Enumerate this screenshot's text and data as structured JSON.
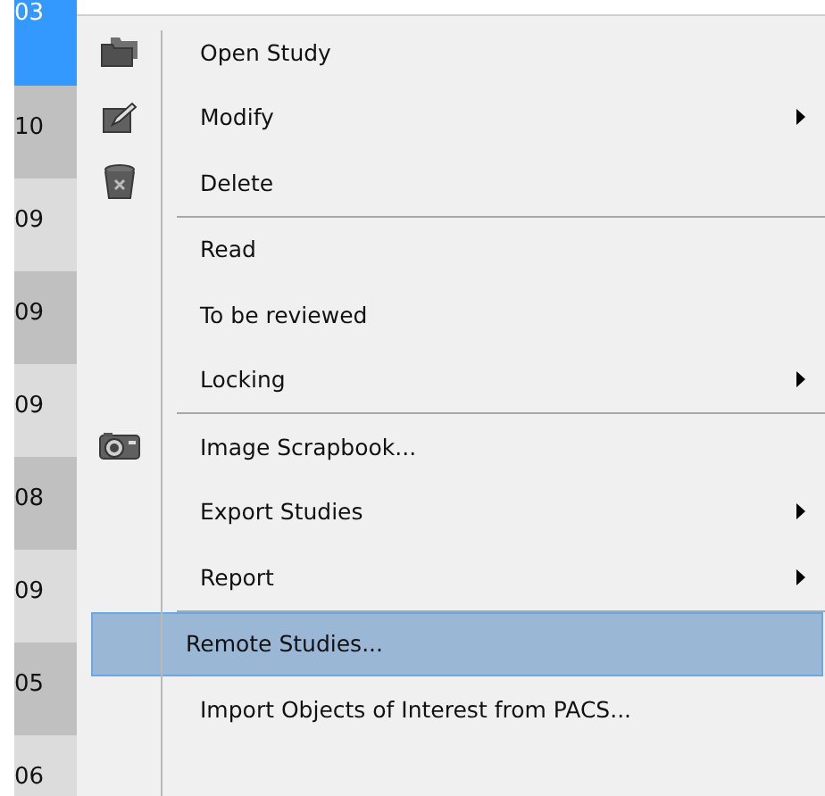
{
  "list_cells": [
    {
      "text": "03",
      "selected": true
    },
    {
      "text": "10",
      "selected": false
    },
    {
      "text": "09",
      "selected": false
    },
    {
      "text": "09",
      "selected": false
    },
    {
      "text": "09",
      "selected": false
    },
    {
      "text": "08",
      "selected": false
    },
    {
      "text": "09",
      "selected": false
    },
    {
      "text": "05",
      "selected": false
    },
    {
      "text": "06",
      "selected": false
    }
  ],
  "context_menu": {
    "items": [
      {
        "kind": "item",
        "label": "Open Study",
        "submenu": false,
        "selected": false
      },
      {
        "kind": "item",
        "label": "Modify",
        "submenu": true,
        "selected": false
      },
      {
        "kind": "item",
        "label": "Delete",
        "submenu": false,
        "selected": false
      },
      {
        "kind": "separator"
      },
      {
        "kind": "item",
        "label": "Read",
        "submenu": false,
        "selected": false
      },
      {
        "kind": "item",
        "label": "To be reviewed",
        "submenu": false,
        "selected": false
      },
      {
        "kind": "item",
        "label": "Locking",
        "submenu": true,
        "selected": false
      },
      {
        "kind": "separator"
      },
      {
        "kind": "item",
        "label": "Image Scrapbook...",
        "submenu": false,
        "selected": false
      },
      {
        "kind": "item",
        "label": "Export Studies",
        "submenu": true,
        "selected": false
      },
      {
        "kind": "item",
        "label": "Report",
        "submenu": true,
        "selected": false
      },
      {
        "kind": "separator"
      },
      {
        "kind": "item",
        "label": "Remote Studies...",
        "submenu": false,
        "selected": true
      },
      {
        "kind": "item",
        "label": "Import Objects of Interest from PACS...",
        "submenu": false,
        "selected": false
      }
    ]
  }
}
